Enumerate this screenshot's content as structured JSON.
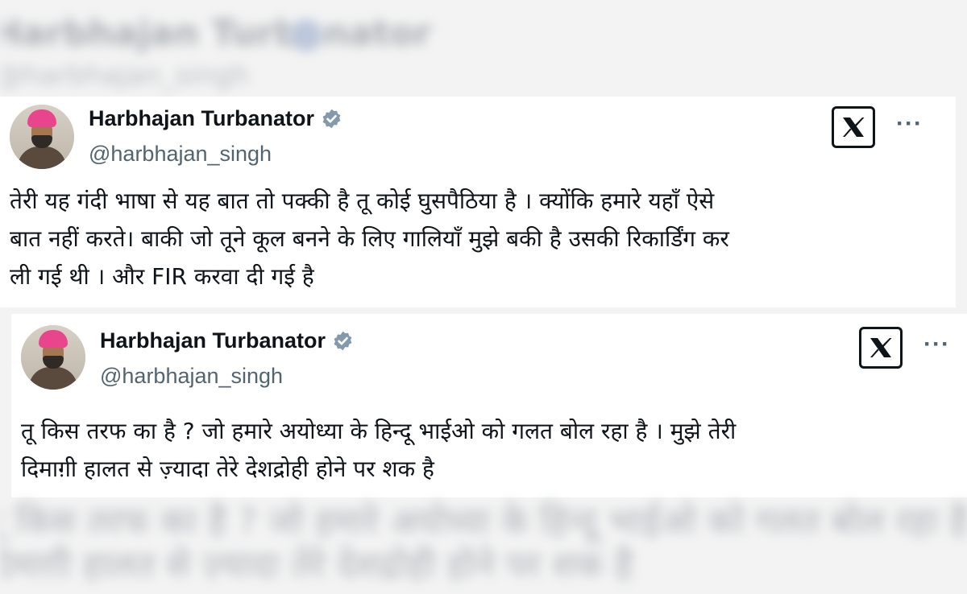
{
  "background": {
    "top_blur": {
      "name": "Harbhajan Turbanator",
      "handle": "@harbhajan_singh"
    },
    "bottom_blur": {
      "line1": "तू किस तरफ का है ? जो हमारे अयोध्या के हिन्दू भाईओ को गलत बोल रहा है । मुझे तेरी",
      "line2": "दिमाग़ी हालत से ज़्यादा तेरे देशद्रोही होने पर शक है"
    }
  },
  "tweets": [
    {
      "name": "Harbhajan Turbanator",
      "handle": "@harbhajan_singh",
      "more_label": "···",
      "text_lines": [
        "तेरी यह गंदी भाषा से यह बात तो पक्की है तू कोई घुसपैठिया है । क्योंकि हमारे यहाँ ऐसे",
        "बात नहीं करते। बाकी जो तूने कूल बनने के लिए गालियाँ मुझे बकी है उसकी रिकार्डिंग कर",
        "ली गई थी । और FIR करवा दी गई है"
      ]
    },
    {
      "name": "Harbhajan Turbanator",
      "handle": "@harbhajan_singh",
      "more_label": "···",
      "text_lines": [
        "तू किस तरफ का है ? जो हमारे अयोध्या के हिन्दू भाईओ को गलत बोल रहा है । मुझे तेरी",
        "दिमाग़ी हालत से ज़्यादा तेरे देशद्रोही होने पर शक है"
      ]
    }
  ],
  "icons": {
    "verified": "verified-badge-icon",
    "x_logo": "x-logo-icon",
    "more": "more-options-icon"
  },
  "colors": {
    "verified_blue": "#829aab",
    "text": "#0f1419",
    "secondary_text": "#536471",
    "turban": "#e8458c"
  }
}
